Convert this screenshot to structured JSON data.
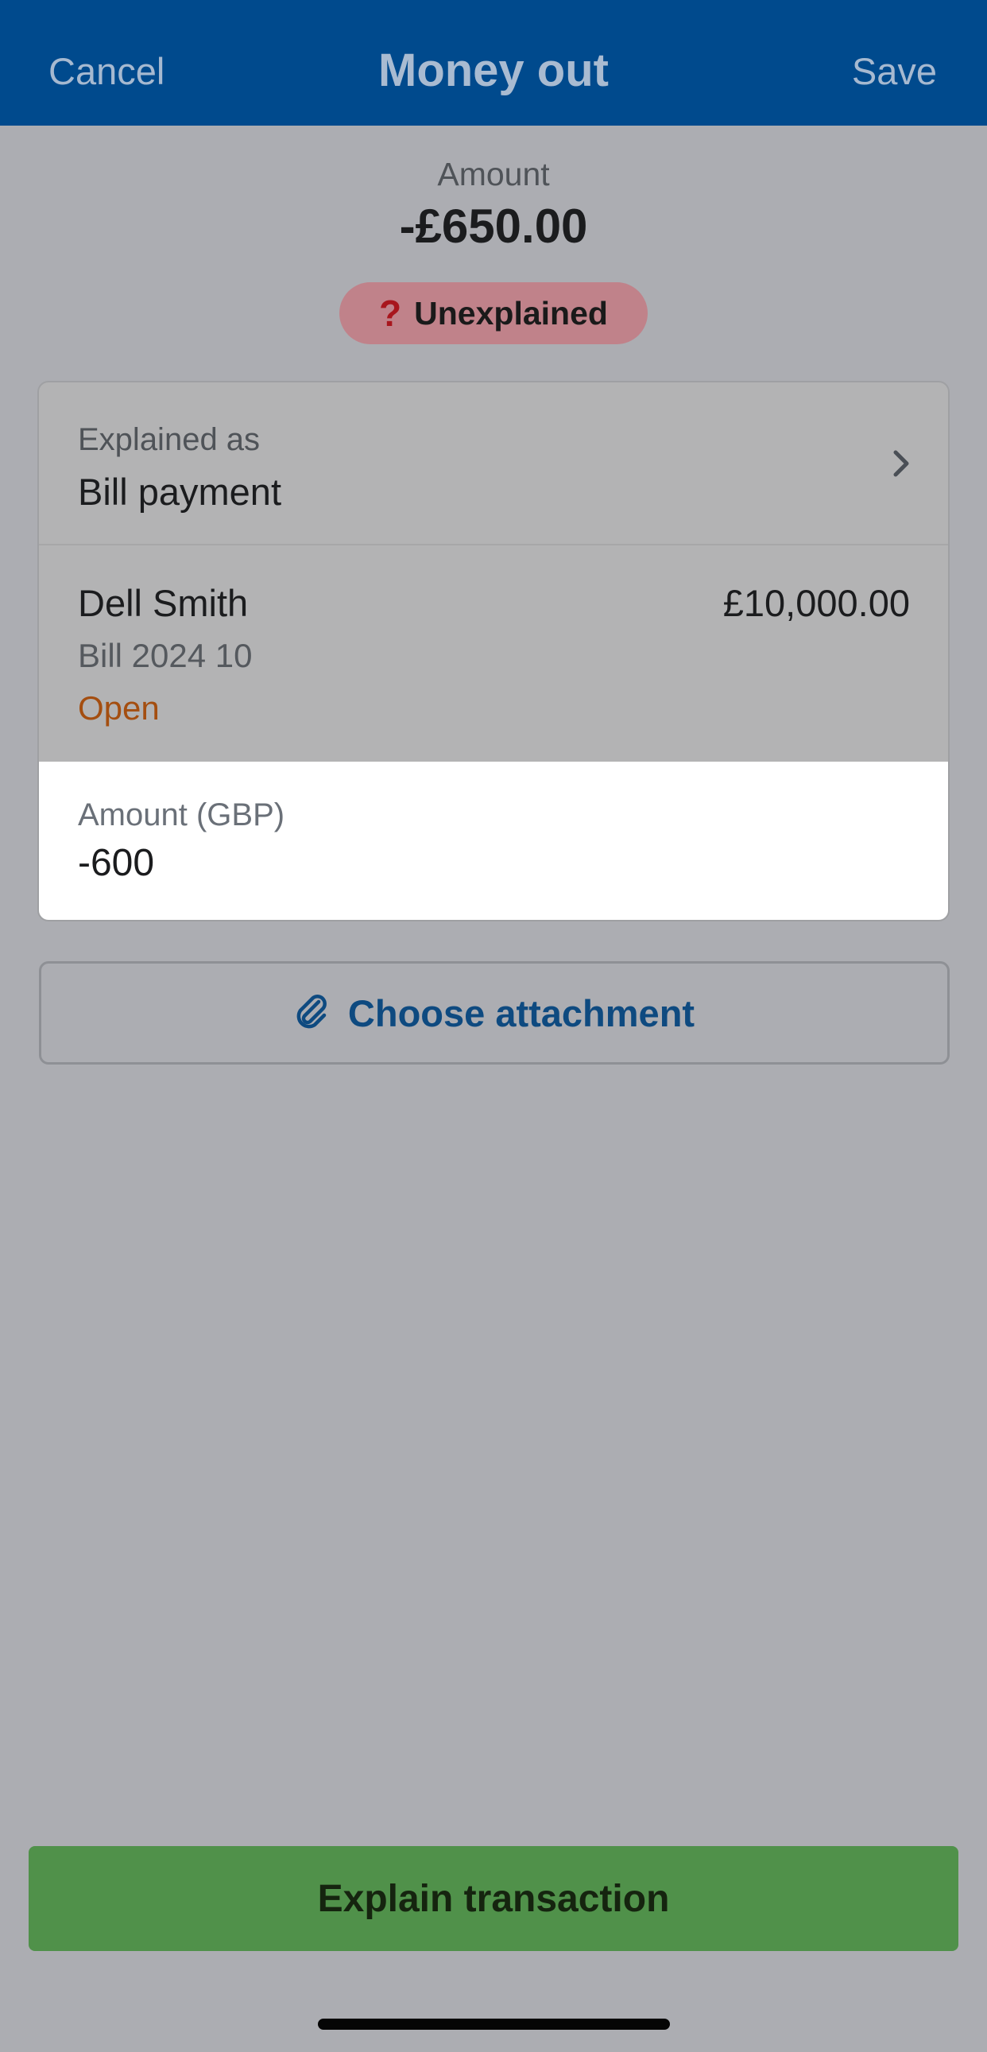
{
  "header": {
    "cancel_label": "Cancel",
    "title": "Money out",
    "save_label": "Save"
  },
  "summary": {
    "amount_label": "Amount",
    "amount_value": "-£650.00",
    "status_icon": "?",
    "status_text": "Unexplained"
  },
  "explanation": {
    "label": "Explained as",
    "value": "Bill payment",
    "chevron_icon": "chevron-right-icon"
  },
  "bill": {
    "contact": "Dell Smith",
    "total": "£10,000.00",
    "reference": "Bill 2024 10",
    "status": "Open"
  },
  "amount_field": {
    "label": "Amount (GBP)",
    "value": "-600"
  },
  "attachment": {
    "icon": "paperclip-icon",
    "label": "Choose attachment"
  },
  "primary_action": {
    "label": "Explain transaction"
  },
  "colors": {
    "header_bg": "#004a8d",
    "badge_bg": "#c0828a",
    "open_status": "#a44e10",
    "attach_text": "#0e4a80",
    "primary_bg": "#50914a"
  }
}
